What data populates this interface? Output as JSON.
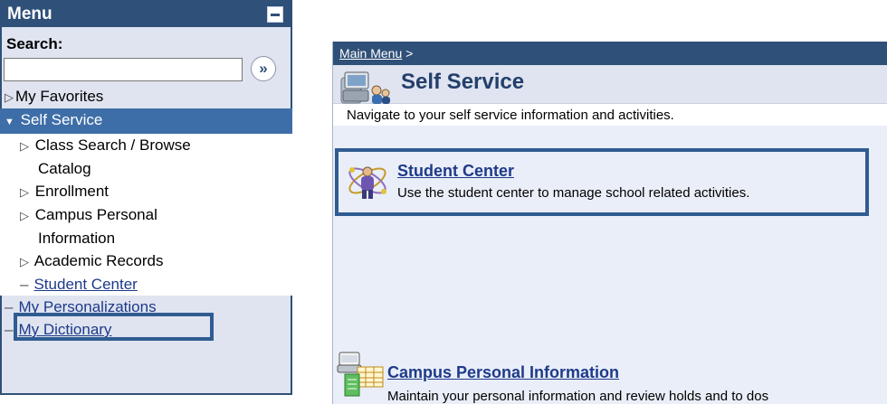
{
  "menu": {
    "title": "Menu",
    "search_label": "Search:",
    "search_value": "",
    "search_go": "»",
    "items": [
      {
        "label": "My Favorites"
      },
      {
        "label": "Self Service"
      }
    ],
    "sub_items": [
      {
        "label": "Class Search / Browse",
        "cont": "Catalog"
      },
      {
        "label": "Enrollment"
      },
      {
        "label": "Campus Personal",
        "cont": "Information"
      },
      {
        "label": "Academic Records"
      },
      {
        "label": "Student Center"
      }
    ],
    "links": [
      {
        "label": "My Personalizations"
      },
      {
        "label": "My Dictionary"
      }
    ]
  },
  "content": {
    "breadcrumb": "Main Menu",
    "breadcrumb_sep": " >",
    "title": "Self Service",
    "description": "Navigate to your self service information and activities.",
    "cards": [
      {
        "title": "Student Center",
        "description": "Use the student center to manage school related activities."
      },
      {
        "title": "Campus Personal Information",
        "description": "Maintain your personal information and review holds and to dos"
      }
    ]
  }
}
